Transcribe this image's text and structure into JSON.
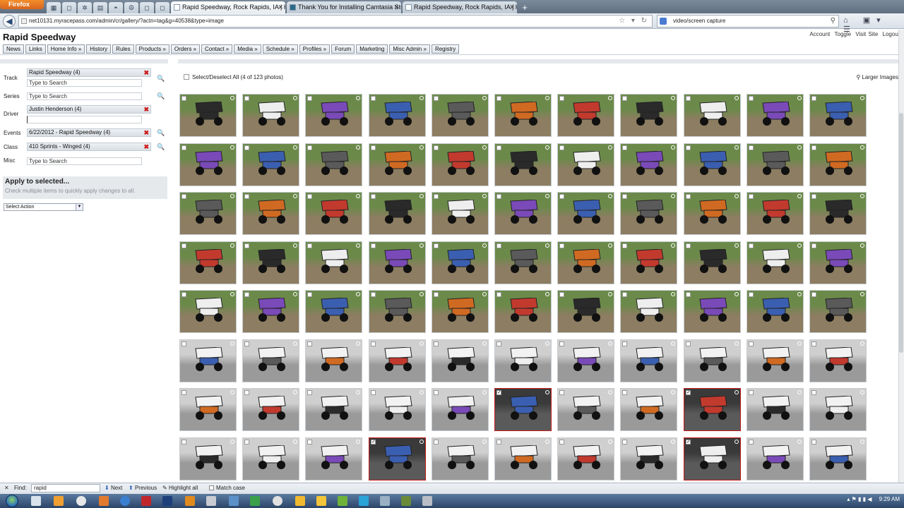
{
  "browser": {
    "firefox_label": "Firefox",
    "tabs": [
      {
        "title": "Rapid Speedway, Rock Rapids, IA | He...",
        "active": true
      },
      {
        "title": "Thank You for Installing Camtasia Stu...",
        "active": false
      },
      {
        "title": "Rapid Speedway, Rock Rapids, IA | He...",
        "active": false
      }
    ],
    "new_tab": "+",
    "close_glyph": "✕",
    "back_glyph": "◀",
    "url": "net10131.myracepass.com/admin/cr/gallery/?actn=tag&g=40538&type=image",
    "url_icons": "☆ ▾ ↻",
    "search_value": "video/screen capture",
    "search_icon": "magnifier-icon",
    "nav_icons": "⌂ ▣▾ ☰"
  },
  "site": {
    "title": "Rapid Speedway",
    "account_links": [
      "Account",
      "Toggle",
      "Visit Site",
      "Logout"
    ],
    "nav": [
      "News",
      "Links",
      "Home Info »",
      "History",
      "Rules",
      "Products »",
      "Orders »",
      "Contact »",
      "Media »",
      "Schedule »",
      "Profiles »",
      "Forum",
      "Marketing",
      "Misc Admin »",
      "Registry"
    ]
  },
  "filters": {
    "track": {
      "label": "Track",
      "chip": "Rapid Speedway (4)",
      "placeholder": "Type to Search"
    },
    "series": {
      "label": "Series",
      "placeholder": "Type to Search"
    },
    "driver": {
      "label": "Driver",
      "chip": "Justin Henderson (4)",
      "value": ""
    },
    "events": {
      "label": "Events",
      "chip": "6/22/2012 - Rapid Speedway (4)"
    },
    "class": {
      "label": "Class",
      "chip": "410 Sprints - Winged (4)"
    },
    "misc": {
      "label": "Misc",
      "placeholder": "Type to Search"
    },
    "remove_glyph": "✖",
    "search_glyph": "🔍"
  },
  "apply": {
    "title": "Apply to selected...",
    "hint": "Check multiple items to quickly apply changes to all.",
    "select_value": "Select Action",
    "dd_glyph": "▼"
  },
  "gallery": {
    "select_all_label": "Select/Deselect All (4 of 123 photos)",
    "larger_images": "Larger Images",
    "check_glyph": "✓",
    "rows": 8,
    "cols": 11,
    "selected": [
      [
        6,
        5
      ],
      [
        6,
        8
      ],
      [
        7,
        3
      ],
      [
        7,
        8
      ]
    ],
    "colors": {
      "dirt": "#8d7d62",
      "grass": "#6b8a4a",
      "grey": "#9a9a9a",
      "selected_border": "#c21a1a"
    }
  },
  "findbar": {
    "close_glyph": "✕",
    "label": "Find:",
    "value": "rapid",
    "next": "Next",
    "previous": "Previous",
    "highlight_all": "Highlight all",
    "match_case": "Match case"
  },
  "taskbar": {
    "time": "9:29 AM",
    "tray_glyphs": "▴ ⚑ ▮ ▮ ◀"
  }
}
